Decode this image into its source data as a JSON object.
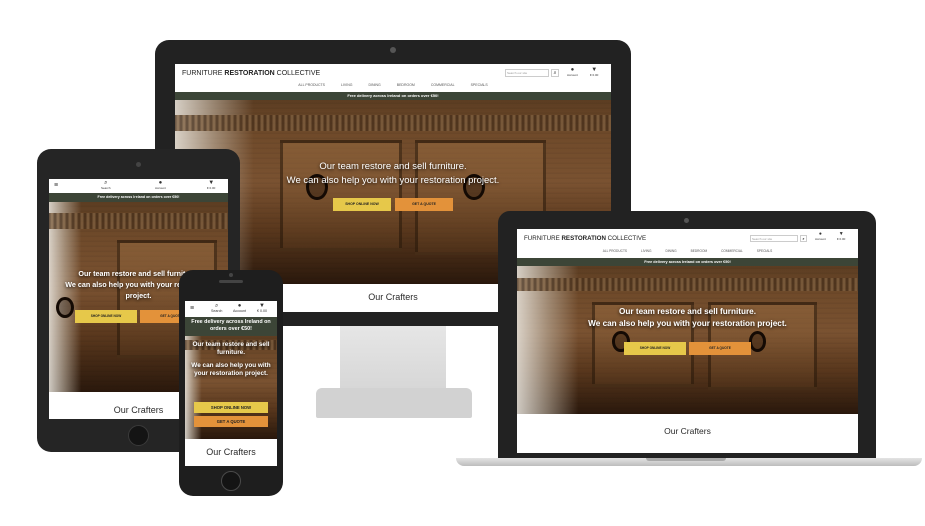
{
  "brand": {
    "prefix": "FURNITURE ",
    "bold": "RESTORATION",
    "suffix": " COLLECTIVE"
  },
  "header": {
    "search_placeholder": "Search our site",
    "account_label": "Account",
    "cart_total": "€ 0.00",
    "search_label": "Search"
  },
  "nav": [
    "All Products",
    "Living",
    "Dining",
    "Bedroom",
    "Commercial",
    "Specials"
  ],
  "banner": {
    "text": "Free delivery across Ireland on orders over €50!"
  },
  "hero": {
    "line1": "Our team restore and sell furniture.",
    "line2": "We can also help you with your restoration project.",
    "shop_button": "Shop online now",
    "quote_button": "Get a quote"
  },
  "section": {
    "crafters_title": "Our Crafters"
  },
  "colors": {
    "banner": "#3c4537",
    "shop_button": "#e6c84a",
    "quote_button": "#e3923a",
    "device_frame": "#1f1f1f"
  }
}
